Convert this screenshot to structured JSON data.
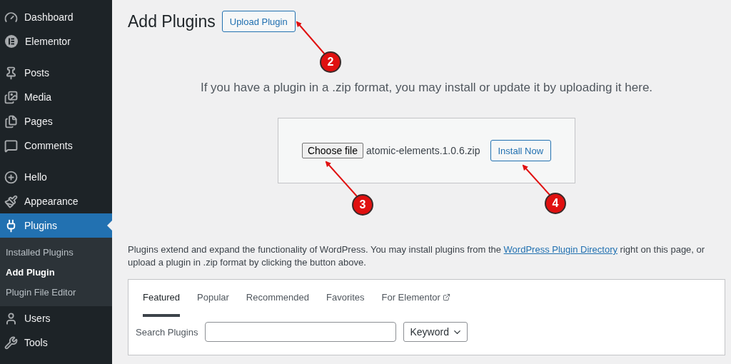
{
  "sidebar": {
    "groups": [
      [
        {
          "label": "Dashboard",
          "selected": false
        },
        {
          "label": "Elementor",
          "selected": false
        }
      ],
      [
        {
          "label": "Posts",
          "selected": false
        },
        {
          "label": "Media",
          "selected": false
        },
        {
          "label": "Pages",
          "selected": false
        },
        {
          "label": "Comments",
          "selected": false
        }
      ],
      [
        {
          "label": "Hello",
          "selected": false
        },
        {
          "label": "Appearance",
          "selected": false
        },
        {
          "label": "Plugins",
          "selected": true,
          "expanded": true,
          "children": [
            {
              "label": "Installed Plugins",
              "selected": false
            },
            {
              "label": "Add Plugin",
              "selected": true
            },
            {
              "label": "Plugin File Editor",
              "selected": false
            }
          ]
        },
        {
          "label": "Users",
          "selected": false
        },
        {
          "label": "Tools",
          "selected": false
        }
      ]
    ]
  },
  "page": {
    "title": "Add Plugins",
    "upload_button": "Upload Plugin"
  },
  "upload": {
    "help": "If you have a plugin in a .zip format, you may install or update it by uploading it here.",
    "choose_button": "Choose file",
    "file_name": "atomic-elements.1.0.6.zip",
    "install_button": "Install Now"
  },
  "description": {
    "before": "Plugins extend and expand the functionality of WordPress. You may install plugins from the ",
    "link": "WordPress Plugin Directory",
    "after": " right on this page, or upload a plugin in .zip format by clicking the button above."
  },
  "filter": {
    "tabs": [
      {
        "label": "Featured",
        "selected": true,
        "external": false
      },
      {
        "label": "Popular",
        "selected": false,
        "external": false
      },
      {
        "label": "Recommended",
        "selected": false,
        "external": false
      },
      {
        "label": "Favorites",
        "selected": false,
        "external": false
      },
      {
        "label": "For Elementor",
        "selected": false,
        "external": true
      }
    ],
    "search_label": "Search Plugins",
    "search_type": "Keyword"
  },
  "annotations": [
    {
      "label": "2"
    },
    {
      "label": "3"
    },
    {
      "label": "4"
    }
  ]
}
